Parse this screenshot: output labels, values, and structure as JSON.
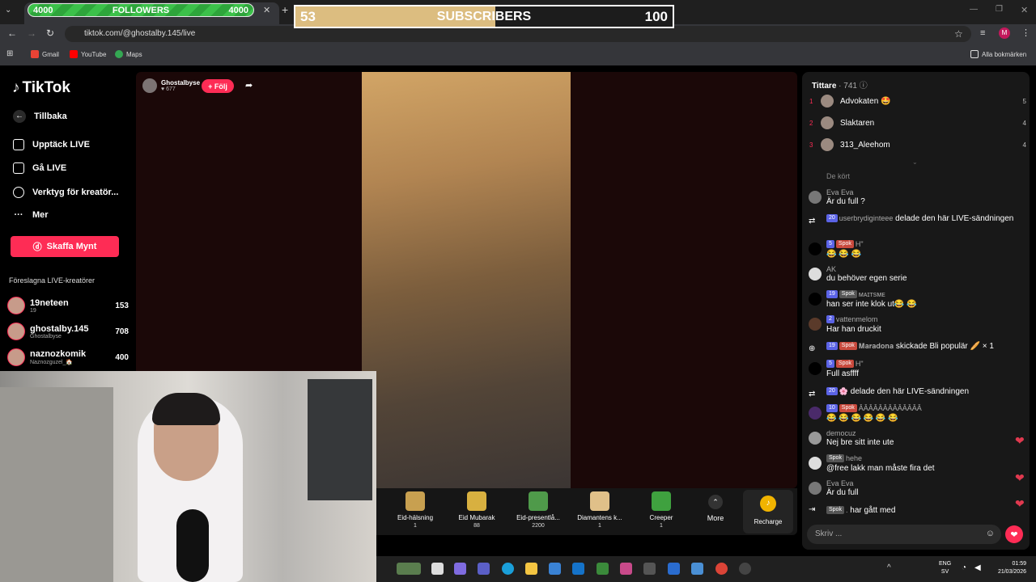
{
  "browser": {
    "followers_bar": {
      "left": "4000",
      "mid": "FOLLOWERS",
      "right": "4000"
    },
    "subscribers_bar": {
      "left": "53",
      "mid": "SUBSCRIBERS",
      "right": "100",
      "progress": 0.53
    },
    "url": "tiktok.com/@ghostalby.145/live",
    "bookmarks": [
      "Gmail",
      "YouTube",
      "Maps"
    ],
    "all_bookmarks": "Alla bokmärken",
    "profile_initial": "M"
  },
  "sidebar": {
    "logo": "TikTok",
    "back": "Tillbaka",
    "nav": [
      "Upptäck LIVE",
      "Gå LIVE",
      "Verktyg för kreatör...",
      "Mer"
    ],
    "coins_button": "Skaffa Mynt",
    "suggested_title": "Föreslagna LIVE-kreatörer",
    "creators": [
      {
        "name": "19neteen",
        "sub": "19",
        "count": "153"
      },
      {
        "name": "ghostalby.145",
        "sub": "Ghostalbyse",
        "count": "708"
      },
      {
        "name": "naznozkomik",
        "sub": "Naznozguzel_🏠",
        "count": "400"
      }
    ]
  },
  "stream": {
    "host_name": "Ghostalbyse",
    "host_likes": "♥ 677",
    "follow_button": "+ Följ"
  },
  "gifts": [
    {
      "name": "Eid-hälsning",
      "price": "1",
      "color": "#c8a050"
    },
    {
      "name": "Eid Mubarak",
      "price": "88",
      "color": "#d8b040"
    },
    {
      "name": "Eid-presentlå...",
      "price": "2200",
      "color": "#4f9a4a"
    },
    {
      "name": "Diamantens k...",
      "price": "1",
      "color": "#e0c089"
    },
    {
      "name": "Creeper",
      "price": "1",
      "color": "#3fa13f"
    }
  ],
  "more_label": "More",
  "recharge_label": "Recharge",
  "chat": {
    "viewers_title": "Tittare",
    "viewers_count": "· 741",
    "top_viewers": [
      {
        "rank": "1",
        "name": "Advokaten 🤩",
        "score": "5"
      },
      {
        "rank": "2",
        "name": "Slaktaren",
        "score": "4"
      },
      {
        "rank": "3",
        "name": "313_Aleehom",
        "score": "4"
      }
    ],
    "truncated_line": "De kört",
    "messages": [
      {
        "user": "Eva Eva",
        "text": "Är du full ?"
      },
      {
        "badge1": "20",
        "user": "userbrydiginteee",
        "text": "delade den här LIVE-sändningen"
      },
      {
        "badge1": "5",
        "badge2": "Spok",
        "user": "H\"",
        "text": "😂 😂 😂"
      },
      {
        "user": "AK",
        "text": "du behöver egen serie"
      },
      {
        "badge1": "19",
        "badge2": "Spok",
        "user": "ᴍᴀɪᴛsᴍᴇ",
        "text": "han ser inte klok ut😂 😂"
      },
      {
        "badge1": "2",
        "user": "vattenmelom",
        "text": "Har han druckit"
      },
      {
        "badge1": "19",
        "badge2": "Spok",
        "user": "𝐌𝐚𝐫𝐚𝐝𝐨𝐧𝐚",
        "text": "skickade Bli populär 🥖 × 1"
      },
      {
        "badge1": "5",
        "badge2": "Spok",
        "user": "H\"",
        "text": "Full asffff"
      },
      {
        "badge1": "20",
        "user": "🌸",
        "text": "delade den här LIVE-sändningen"
      },
      {
        "badge1": "10",
        "badge2": "Spok",
        "user": "ÂÂÂÂÂÂÂÂÂÂÂÂÂ",
        "text": "😂 😂 😂 😂 😂 😂"
      },
      {
        "user": "democuz",
        "text": "Nej bre sitt inte ute"
      },
      {
        "badge2": "Spok",
        "user": "hehe",
        "text": "@free lakk man måste fira det"
      },
      {
        "user": "Eva Eva",
        "text": "Är du full"
      },
      {
        "badge2": "Spok",
        "user": ".",
        "text": "har gått med"
      }
    ],
    "input_placeholder": "Skriv ..."
  },
  "taskbar": {
    "lang": "ENG",
    "lang_sub": "SV",
    "time": "01:59",
    "date": "21/03/2026"
  }
}
